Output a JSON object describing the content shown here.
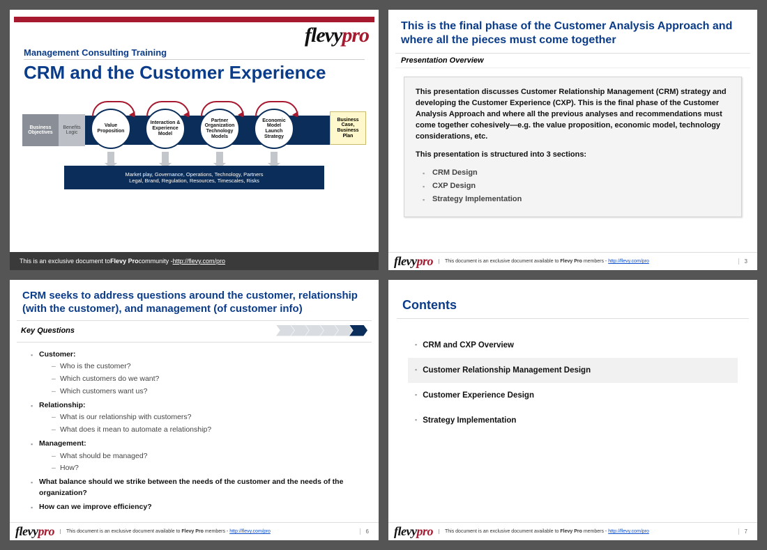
{
  "logo": {
    "part1": "flevy",
    "part2": "pro"
  },
  "slide1": {
    "subtitle": "Management Consulting Training",
    "title": "CRM and the Customer Experience",
    "box_business_objectives": "Business Objectives",
    "box_benefits_logic": "Benefits Logic",
    "circles": [
      "Value Proposition",
      "Interaction & Experience Model",
      "Partner Organization Technology Models",
      "Economic Model Launch Strategy"
    ],
    "endbox": "Business Case, Business Plan",
    "below_l1": "Market play, Governance, Operations, Technology, Partners",
    "below_l2": "Legal, Brand, Regulation, Resources, Timescales, Risks",
    "footer_pre": "This is an exclusive document to ",
    "footer_bold": "Flevy Pro",
    "footer_post": " community - ",
    "footer_url": "http://flevy.com/pro"
  },
  "slide2": {
    "title": "This is the final phase of the Customer Analysis Approach and where all the pieces must come together",
    "subtitle": "Presentation Overview",
    "para1": "This presentation discusses Customer Relationship Management (CRM) strategy and developing the Customer Experience (CXP).  This is the final phase of the Customer Analysis Approach and where all the previous analyses and recommendations must come together cohesively—e.g. the value proposition, economic model, technology considerations, etc.",
    "para2": "This presentation is structured into 3 sections:",
    "bullets": [
      "CRM Design",
      "CXP Design",
      "Strategy Implementation"
    ],
    "page": "3"
  },
  "slide3": {
    "title": "CRM seeks to address questions around the customer, relationship (with the customer), and management (of customer info)",
    "kq": "Key Questions",
    "groups": [
      {
        "head": "Customer:",
        "subs": [
          "Who is the customer?",
          "Which customers do we want?",
          "Which customers want us?"
        ]
      },
      {
        "head": "Relationship:",
        "subs": [
          "What is our relationship with customers?",
          "What does it mean to automate a relationship?"
        ]
      },
      {
        "head": "Management:",
        "subs": [
          "What should be managed?",
          "How?"
        ]
      }
    ],
    "bold_q1": "What balance should we strike between the needs of the customer and the needs of the organization?",
    "bold_q2": "How can we improve efficiency?",
    "page": "6"
  },
  "slide4": {
    "title": "Contents",
    "items": [
      {
        "label": "CRM and CXP Overview",
        "hl": false
      },
      {
        "label": "Customer Relationship Management Design",
        "hl": true
      },
      {
        "label": "Customer Experience Design",
        "hl": false
      },
      {
        "label": "Strategy Implementation",
        "hl": false
      }
    ],
    "page": "7"
  },
  "footer_small": {
    "pre": "This document is an exclusive document available to ",
    "bold": "Flevy Pro",
    "mid": " members - ",
    "url": "http://flevy.com/pro"
  }
}
